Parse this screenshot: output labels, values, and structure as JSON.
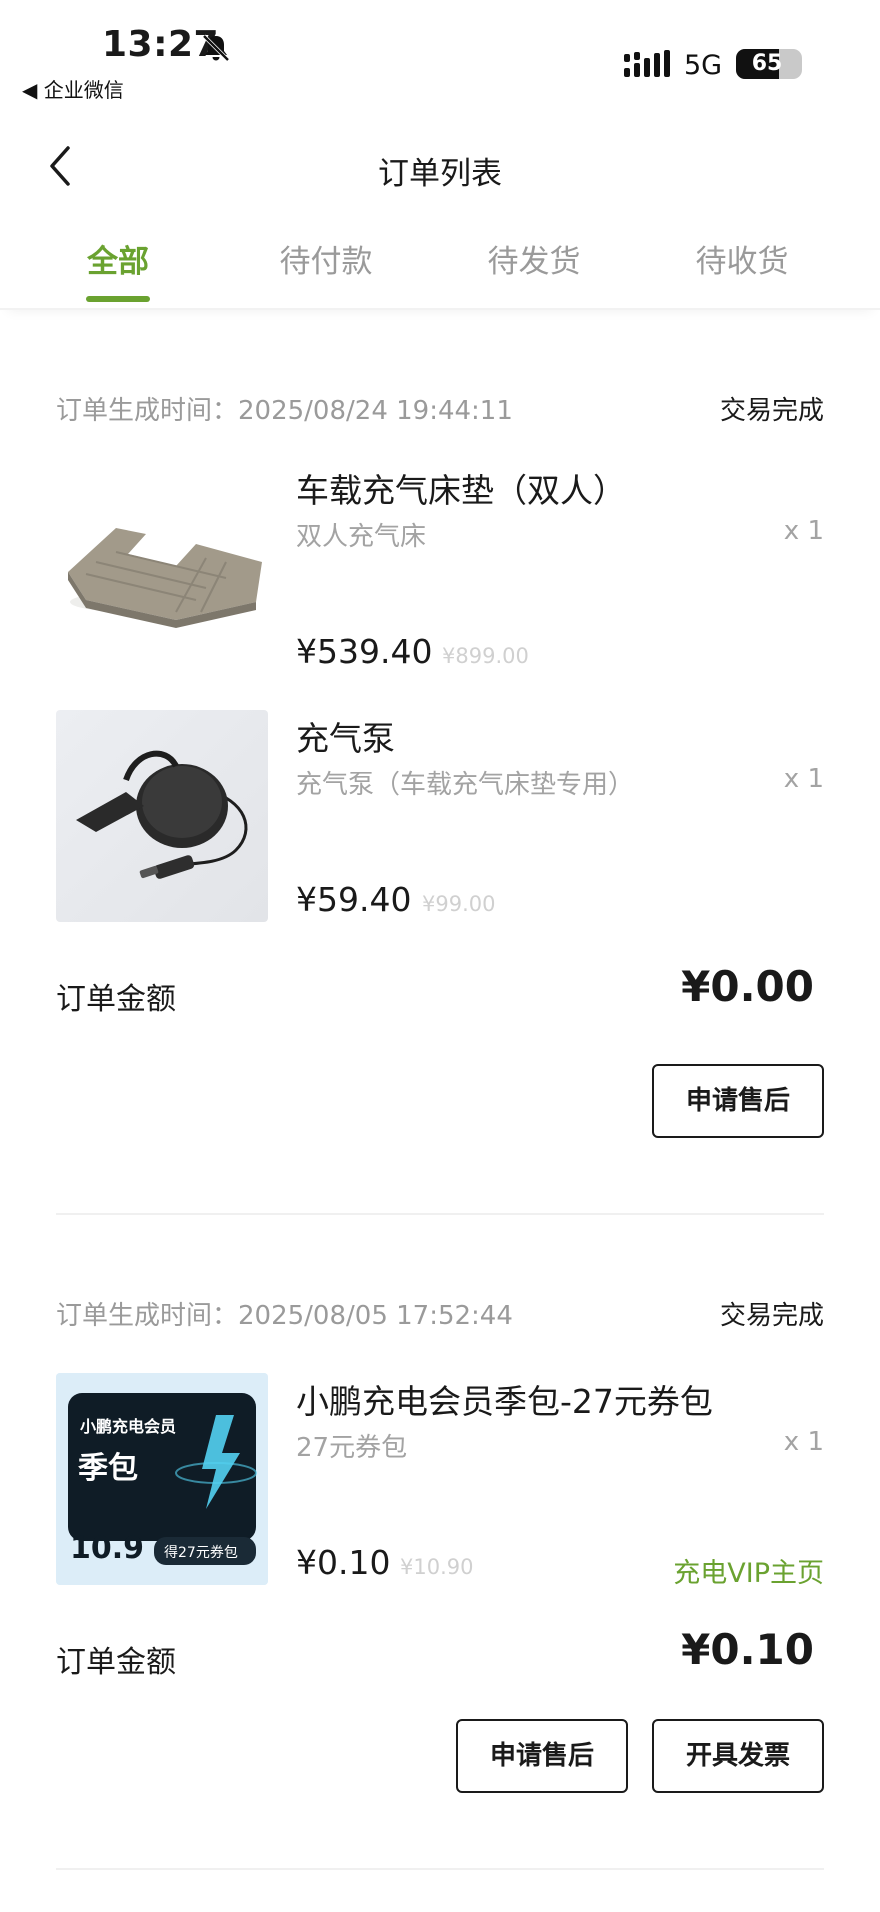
{
  "status_bar": {
    "time": "13:27",
    "back_app": "◀ 企业微信",
    "network": "5G",
    "battery": "65",
    "battery_level": 0.65
  },
  "nav": {
    "title": "订单列表"
  },
  "tabs": [
    {
      "label": "全部",
      "active": true
    },
    {
      "label": "待付款",
      "active": false
    },
    {
      "label": "待发货",
      "active": false
    },
    {
      "label": "待收货",
      "active": false
    }
  ],
  "orders": [
    {
      "time_label": "订单生成时间：2025/08/24 19:44:11",
      "status": "交易完成",
      "items": [
        {
          "title": "车载充气床垫（双人）",
          "subtitle": "双人充气床",
          "qty": "x 1",
          "price": "¥539.40",
          "original_price": "¥899.00"
        },
        {
          "title": "充气泵",
          "subtitle": "充气泵（车载充气床垫专用）",
          "qty": "x 1",
          "price": "¥59.40",
          "original_price": "¥99.00"
        }
      ],
      "amount_label": "订单金额",
      "amount": "¥0.00",
      "buttons": [
        "申请售后"
      ]
    },
    {
      "time_label": "订单生成时间：2025/08/05 17:52:44",
      "status": "交易完成",
      "items": [
        {
          "title": "小鹏充电会员季包-27元券包",
          "subtitle": "27元券包",
          "qty": "x 1",
          "price": "¥0.10",
          "original_price": "¥10.90",
          "link": "充电VIP主页",
          "thumb_text": {
            "brand": "小鹏充电会员",
            "name": "季包",
            "price": "10.9",
            "tag": "得27元券包"
          }
        }
      ],
      "amount_label": "订单金额",
      "amount": "¥0.10",
      "buttons": [
        "申请售后",
        "开具发票"
      ]
    }
  ],
  "colors": {
    "accent": "#6aa230",
    "text": "#1a1a1a",
    "muted": "#9a9a9a"
  }
}
